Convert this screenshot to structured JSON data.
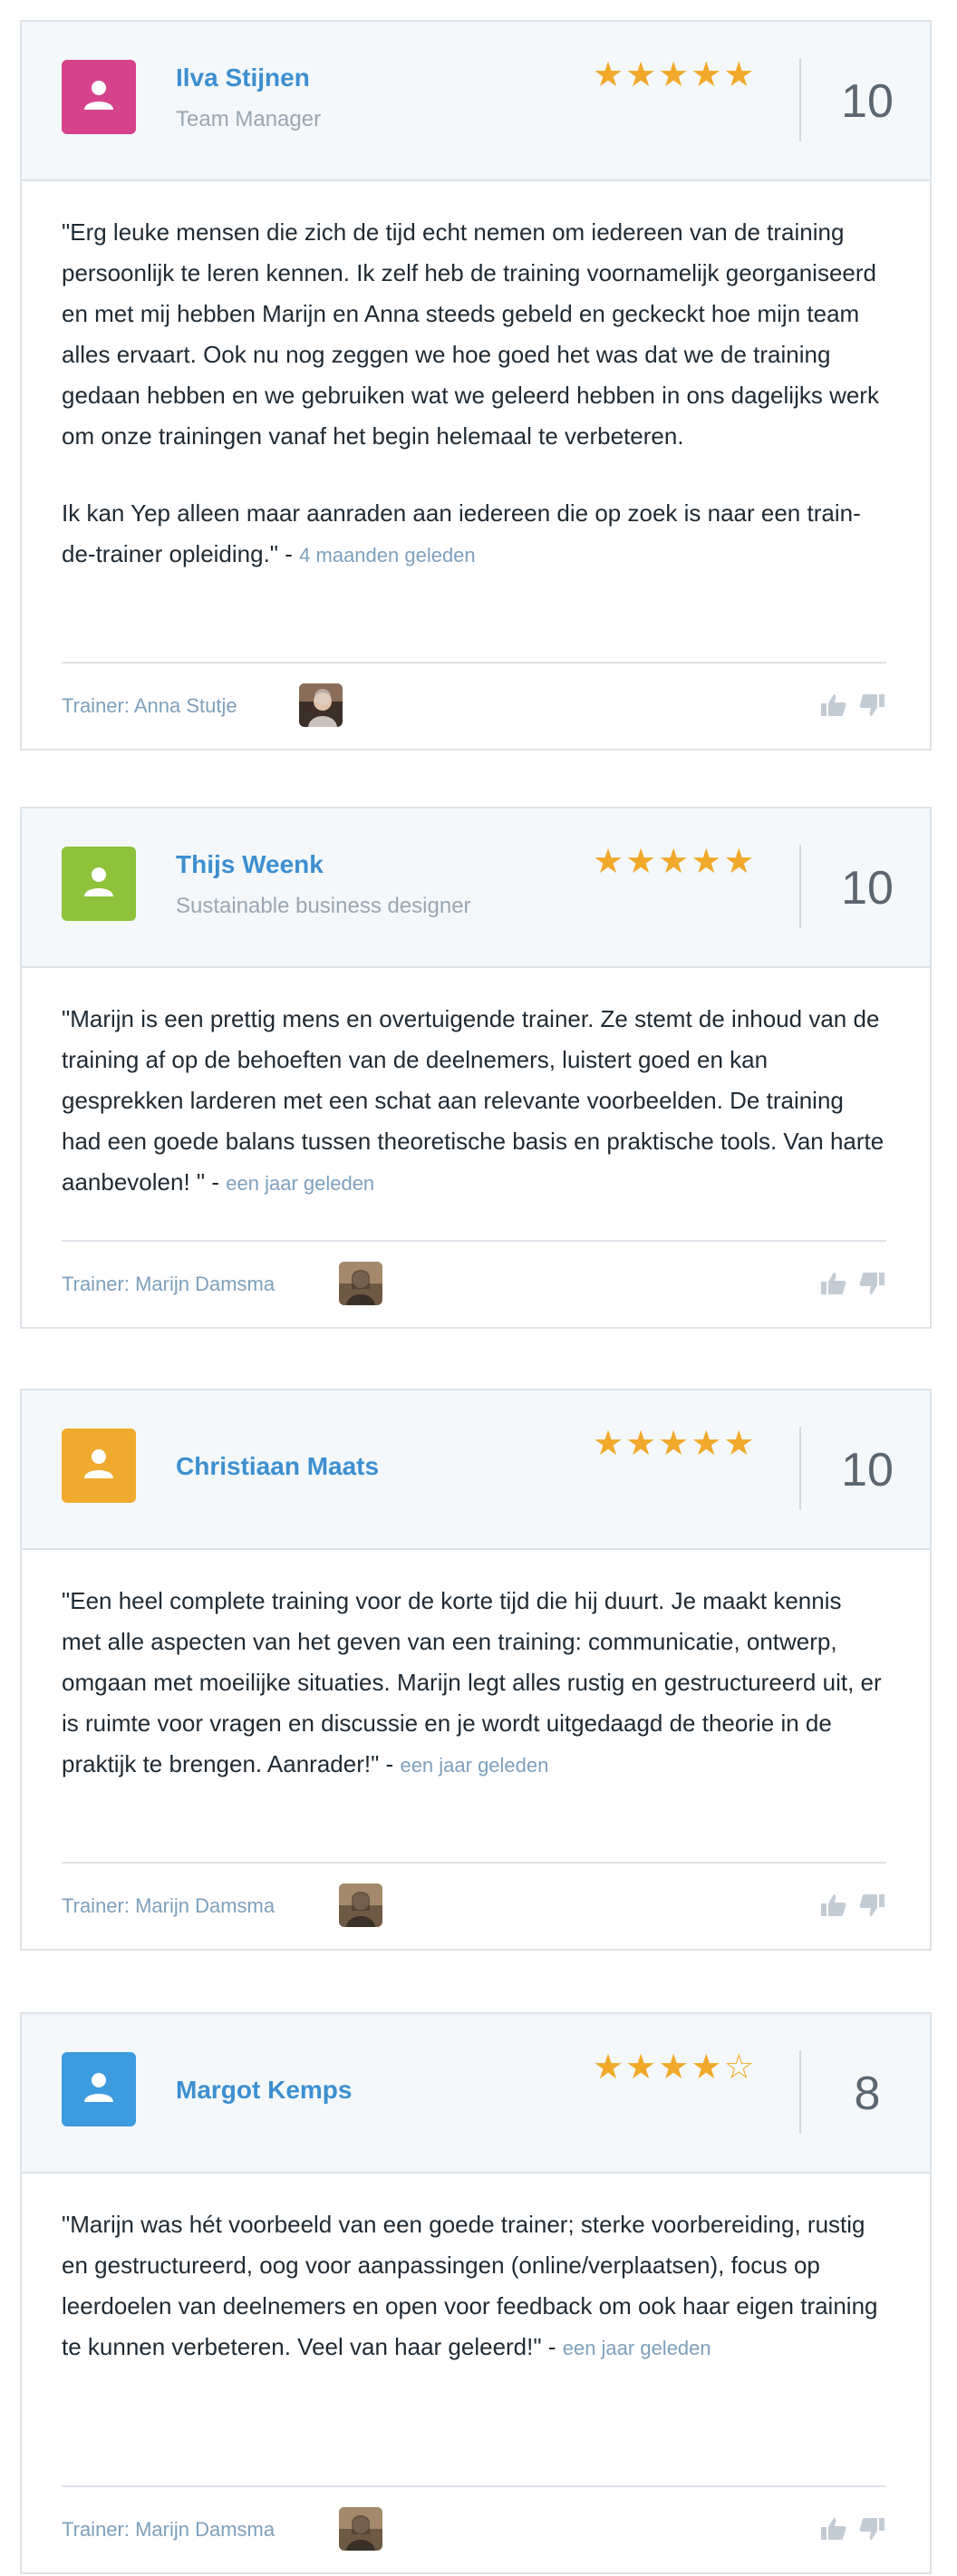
{
  "colors": {
    "avatar_pink": "#d6438b",
    "avatar_green": "#8dc23a",
    "avatar_orange": "#f0ab2f",
    "avatar_blue": "#3d9be0",
    "star": "#f1a92b",
    "link": "#3d8fd0"
  },
  "reviews": [
    {
      "name": "Ilva Stijnen",
      "role": "Team Manager",
      "stars": "★★★★★",
      "score": "10",
      "text": "\"Erg leuke mensen die zich de tijd echt nemen om iedereen van de training persoonlijk te leren kennen. Ik zelf heb de training voornamelijk georganiseerd en met mij hebben Marijn en Anna steeds gebeld en geckeckt hoe mijn team alles ervaart. Ook nu nog zeggen we hoe goed het was dat we de training gedaan hebben en we gebruiken wat we geleerd hebben in ons dagelijks werk om onze trainingen vanaf het begin helemaal te verbeteren.",
      "text2": "Ik kan Yep alleen maar aanraden aan iedereen die op zoek is naar een train-de-trainer opleiding.\" -",
      "ago": "4 maanden geleden",
      "trainer": "Trainer: Anna Stutje"
    },
    {
      "name": "Thijs Weenk",
      "role": "Sustainable business designer",
      "stars": "★★★★★",
      "score": "10",
      "text": "\"Marijn is een prettig mens en overtuigende trainer. Ze stemt de inhoud van de training af op de behoeften van de deelnemers, luistert goed en kan gesprekken larderen met een schat aan relevante voorbeelden. De training had een goede balans tussen theoretische basis en praktische tools. Van harte aanbevolen! \" -",
      "ago": "een jaar geleden",
      "trainer": "Trainer: Marijn Damsma"
    },
    {
      "name": "Christiaan Maats",
      "stars": "★★★★★",
      "score": "10",
      "text": "\"Een heel complete training voor de korte tijd die hij duurt. Je maakt kennis met alle aspecten van het geven van een training: communicatie, ontwerp, omgaan met moeilijke situaties. Marijn legt alles rustig en gestructureerd uit, er is ruimte voor vragen en discussie en je wordt uitgedaagd de theorie in de praktijk te brengen. Aanrader!\" -",
      "ago": "een jaar geleden",
      "trainer": "Trainer: Marijn Damsma"
    },
    {
      "name": "Margot Kemps",
      "stars": "★★★★☆",
      "score": "8",
      "text": "\"Marijn was hét voorbeeld van een goede trainer; sterke voorbereiding, rustig en gestructureerd, oog voor aanpassingen (online/verplaatsen), focus op leerdoelen van deelnemers en open voor feedback om ook haar eigen training te kunnen verbeteren. Veel van haar geleerd!\" -",
      "ago": "een jaar geleden",
      "trainer": "Trainer: Marijn Damsma"
    }
  ]
}
